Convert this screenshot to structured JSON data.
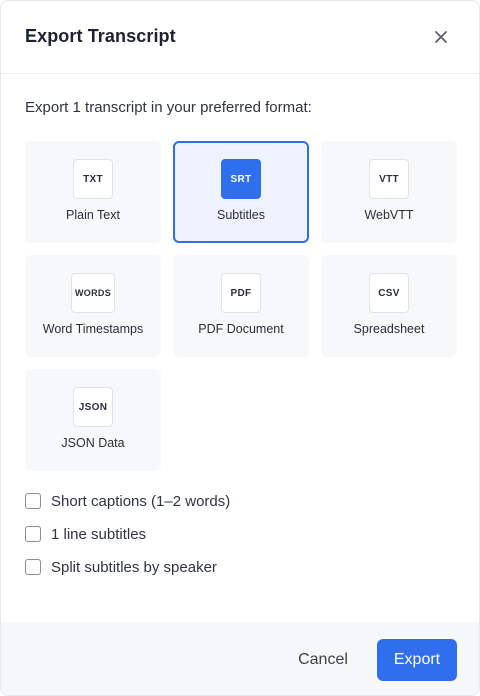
{
  "dialog": {
    "title": "Export Transcript",
    "subtitle": "Export 1 transcript in your preferred format:"
  },
  "formats": [
    {
      "badge": "TXT",
      "label": "Plain Text",
      "selected": false
    },
    {
      "badge": "SRT",
      "label": "Subtitles",
      "selected": true
    },
    {
      "badge": "VTT",
      "label": "WebVTT",
      "selected": false
    },
    {
      "badge": "WORDS",
      "label": "Word Timestamps",
      "selected": false
    },
    {
      "badge": "PDF",
      "label": "PDF Document",
      "selected": false
    },
    {
      "badge": "CSV",
      "label": "Spreadsheet",
      "selected": false
    },
    {
      "badge": "JSON",
      "label": "JSON Data",
      "selected": false
    }
  ],
  "options": [
    {
      "label": "Short captions (1–2 words)",
      "checked": false
    },
    {
      "label": "1 line subtitles",
      "checked": false
    },
    {
      "label": "Split subtitles by speaker",
      "checked": false
    }
  ],
  "footer": {
    "cancel_label": "Cancel",
    "export_label": "Export"
  },
  "colors": {
    "accent": "#2f6fee",
    "card_bg": "#f7f8fa",
    "footer_bg": "#f6f7f9"
  },
  "icons": {
    "close": "close-icon"
  }
}
